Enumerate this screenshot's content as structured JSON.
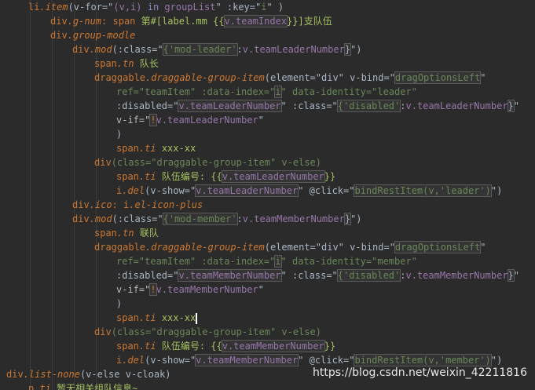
{
  "lines": [
    [
      "li",
      ".item",
      "(v-for=\"",
      "(v,i)",
      " in ",
      "groupList",
      "\" :key=\"",
      "i",
      "\" )"
    ],
    [
      "div",
      ".g-num",
      ": span ",
      "第#[label.mm {{",
      "v.teamIndex",
      "}}]支队伍"
    ],
    [
      "div",
      ".group-modle"
    ],
    [
      "div",
      ".mod",
      "(:class=\"",
      "{'mod-leader'",
      ":",
      "v.teamLeaderNumber",
      "}",
      "\")"
    ],
    [
      "span",
      ".tn",
      " 队长"
    ],
    [
      "draggable",
      ".draggable-group-item",
      "(element=\"div\" v-bind=\"",
      "dragOptionsLeft",
      "\""
    ],
    [
      "ref=\"teamItem\" :data-index=\"",
      "i",
      "\" data-identity=\"leader\""
    ],
    [
      ":disabled=\"",
      "v.teamLeaderNumber",
      "\" :class=\"",
      "{'disabled'",
      ":",
      "v.teamLeaderNumber",
      "}",
      "\""
    ],
    [
      "v-if=\"",
      "!",
      "v.teamLeaderNumber",
      "\""
    ],
    [
      ")"
    ],
    [
      "span",
      ".ti",
      " xxx-xx"
    ],
    [
      "div",
      "(class=\"draggable-group-item\" v-else)"
    ],
    [
      "span",
      ".ti",
      " 队伍编号: {{",
      "v.teamLeaderNumber",
      "}}"
    ],
    [
      "i",
      ".del",
      "(v-show=\"",
      "v.teamLeaderNumber",
      "\" @click=\"",
      "bindRestItem(v,'leader')",
      "\")"
    ],
    [
      "div",
      ".ico",
      ": i",
      ".el-icon-plus"
    ],
    [
      "div",
      ".mod",
      "(:class=\"",
      "{'mod-member'",
      ":",
      "v.teamMemberNumber",
      "}",
      "\")"
    ],
    [
      "span",
      ".tn",
      " 联队"
    ],
    [
      "draggable",
      ".draggable-group-item",
      "(element=\"div\" v-bind=\"",
      "dragOptionsLeft",
      "\""
    ],
    [
      "ref=\"teamItem\" :data-index=\"",
      "i",
      "\" data-identity=\"member\""
    ],
    [
      ":disabled=\"",
      "v.teamMemberNumber",
      "\" :class=\"",
      "{'disabled'",
      ":",
      "v.teamMemberNumber",
      "}",
      "\""
    ],
    [
      "v-if=\"",
      "!",
      "v.teamMemberNumber",
      "\""
    ],
    [
      ")"
    ],
    [
      "span",
      ".ti",
      " xxx-xx"
    ],
    [
      "div",
      "(class=\"draggable-group-item\" v-else)"
    ],
    [
      "span",
      ".ti",
      " 队伍编号: {{",
      "v.teamMemberNumber",
      "}}"
    ],
    [
      "i",
      ".del",
      "(v-show=\"",
      "v.teamMemberNumber",
      "\" @click=\"",
      "bindRestItem(v,'member')",
      "\")"
    ],
    [
      "div",
      ".list-none",
      "(v-else v-cloak)"
    ],
    [
      "p",
      ".ti",
      " 暂无相关组队信息~"
    ]
  ],
  "watermark": "https://blog.csdn.net/weixin_42211816"
}
